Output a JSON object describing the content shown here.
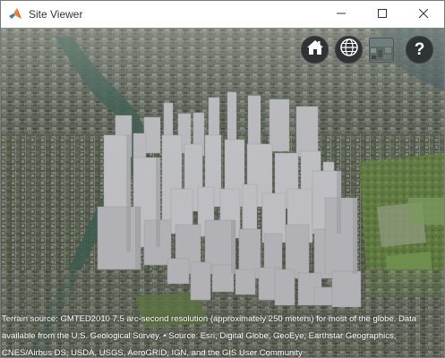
{
  "window": {
    "title": "Site Viewer",
    "app_icon": "matlab-icon",
    "controls": [
      "minimize-icon",
      "maximize-icon",
      "close-icon"
    ]
  },
  "toolbar": {
    "home_icon": "home-icon",
    "globe_icon": "globe-icon",
    "basemap_icon": "basemap-picker-icon",
    "help_label": "?"
  },
  "credits": {
    "line1": "Terrain source: GMTED2010 7.5 arc-second resolution (approximately 250 meters) for most of the globe. Data",
    "line2": "available from the U.S. Geological Survey. • Source: Esri, Digital Globe, GeoEye, Earthstar Geographics,",
    "line3": "CNES/Airbus DS, USDA, USGS, AeroGRID, IGN, and the GIS User Community"
  },
  "colors": {
    "building": "#b9b9bd",
    "button_bg": "#303336",
    "credits_text": "#ffffff"
  }
}
